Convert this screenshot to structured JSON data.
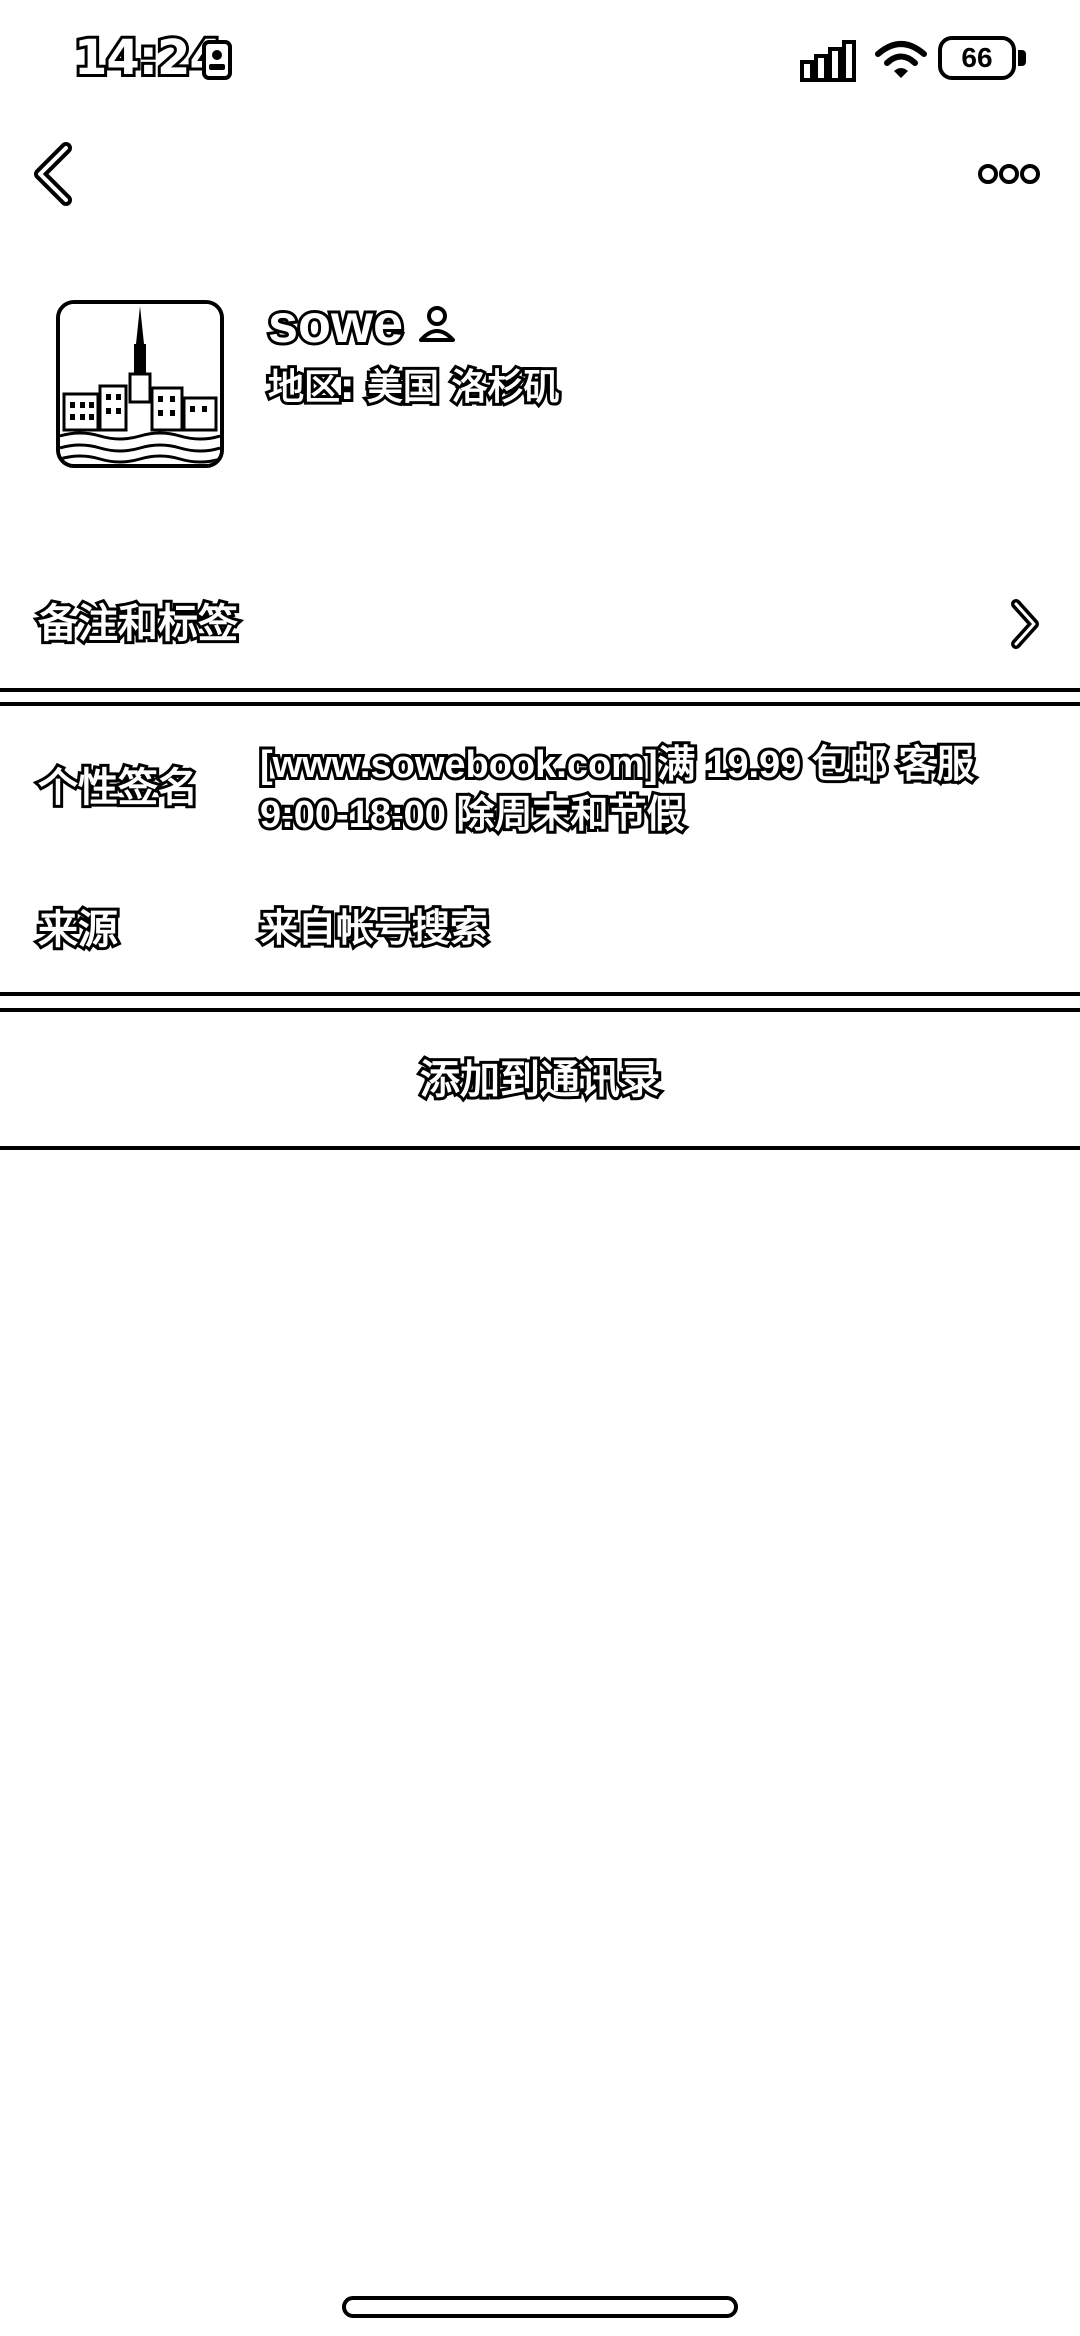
{
  "status_bar": {
    "time": "14:24",
    "battery": "66",
    "icons": [
      "person-card-icon",
      "signal-icon",
      "wifi-icon",
      "battery-icon"
    ]
  },
  "nav": {
    "back_icon": "chevron-left-icon",
    "more_icon": "more-dots-icon"
  },
  "profile": {
    "name": "sowe",
    "name_icon": "contact-person-icon",
    "region": "地区: 美国 洛杉矶",
    "avatar_icon": "city-church-skyline-avatar"
  },
  "rows": {
    "notes_tags": "备注和标签",
    "signature_label": "个性签名",
    "signature_value": "[www.sowebook.com]满 19.99 包邮 客服 9:00-18:00 除周末和节假",
    "source_label": "来源",
    "source_value": "来自帐号搜索"
  },
  "actions": {
    "add_to_contacts": "添加到通讯录"
  },
  "colors": {
    "background": "#ffffff",
    "outline": "#000000"
  }
}
